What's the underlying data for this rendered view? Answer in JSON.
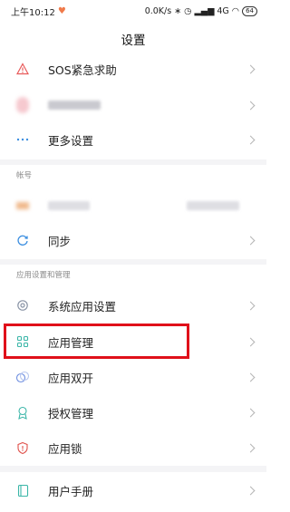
{
  "status_bar": {
    "time": "上午10:12",
    "network_speed": "0.0K/s",
    "signal": "4G",
    "battery": "64"
  },
  "title": "设置",
  "rows": {
    "sos": {
      "label": "SOS紧急求助",
      "icon": "warning-triangle-icon"
    },
    "more": {
      "label": "更多设置",
      "icon": "more-dots-icon"
    },
    "sync": {
      "label": "同步",
      "icon": "sync-icon"
    },
    "system_apps": {
      "label": "系统应用设置",
      "icon": "settings-ring-icon"
    },
    "app_manage": {
      "label": "应用管理",
      "icon": "grid-icon"
    },
    "dual_apps": {
      "label": "应用双开",
      "icon": "dual-circle-icon"
    },
    "permissions": {
      "label": "授权管理",
      "icon": "badge-icon"
    },
    "app_lock": {
      "label": "应用锁",
      "icon": "shield-icon"
    },
    "manual": {
      "label": "用户手册",
      "icon": "book-icon"
    }
  },
  "sections": {
    "account": "帐号",
    "apps": "应用设置和管理"
  },
  "colors": {
    "accent": "#3b8ee0",
    "highlight": "#e0101a",
    "sos": "#e85a5a",
    "lock": "#e0504a"
  }
}
